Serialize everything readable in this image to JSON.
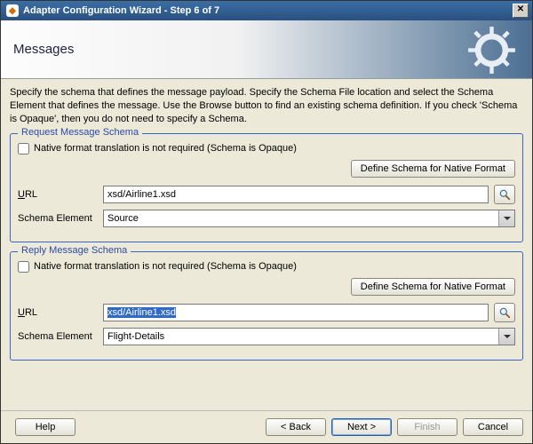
{
  "window": {
    "title": "Adapter Configuration Wizard - Step 6 of 7",
    "close_glyph": "✕"
  },
  "banner": {
    "page_title": "Messages"
  },
  "intro_text": "Specify the schema that defines the message payload.  Specify the Schema File location and select the Schema Element that defines the message. Use the Browse button to find an existing schema definition. If you check 'Schema is Opaque', then you do not need to specify a Schema.",
  "request": {
    "legend": "Request Message Schema",
    "opaque_label": "Native format translation is not required (Schema is Opaque)",
    "define_btn": "Define Schema for Native Format",
    "url_label_pre": "U",
    "url_label_post": "RL",
    "url_value": "xsd/Airline1.xsd",
    "schema_elem_label": "Schema Element",
    "schema_elem_value": "Source"
  },
  "reply": {
    "legend": "Reply Message Schema",
    "opaque_label": "Native format translation is not required (Schema is Opaque)",
    "define_btn": "Define Schema for Native Format",
    "url_label_pre": "U",
    "url_label_post": "RL",
    "url_value": "xsd/Airline1.xsd",
    "schema_elem_label": "Schema Element",
    "schema_elem_value": "Flight-Details"
  },
  "footer": {
    "help": "Help",
    "back": "< Back",
    "next": "Next >",
    "finish": "Finish",
    "cancel": "Cancel"
  }
}
